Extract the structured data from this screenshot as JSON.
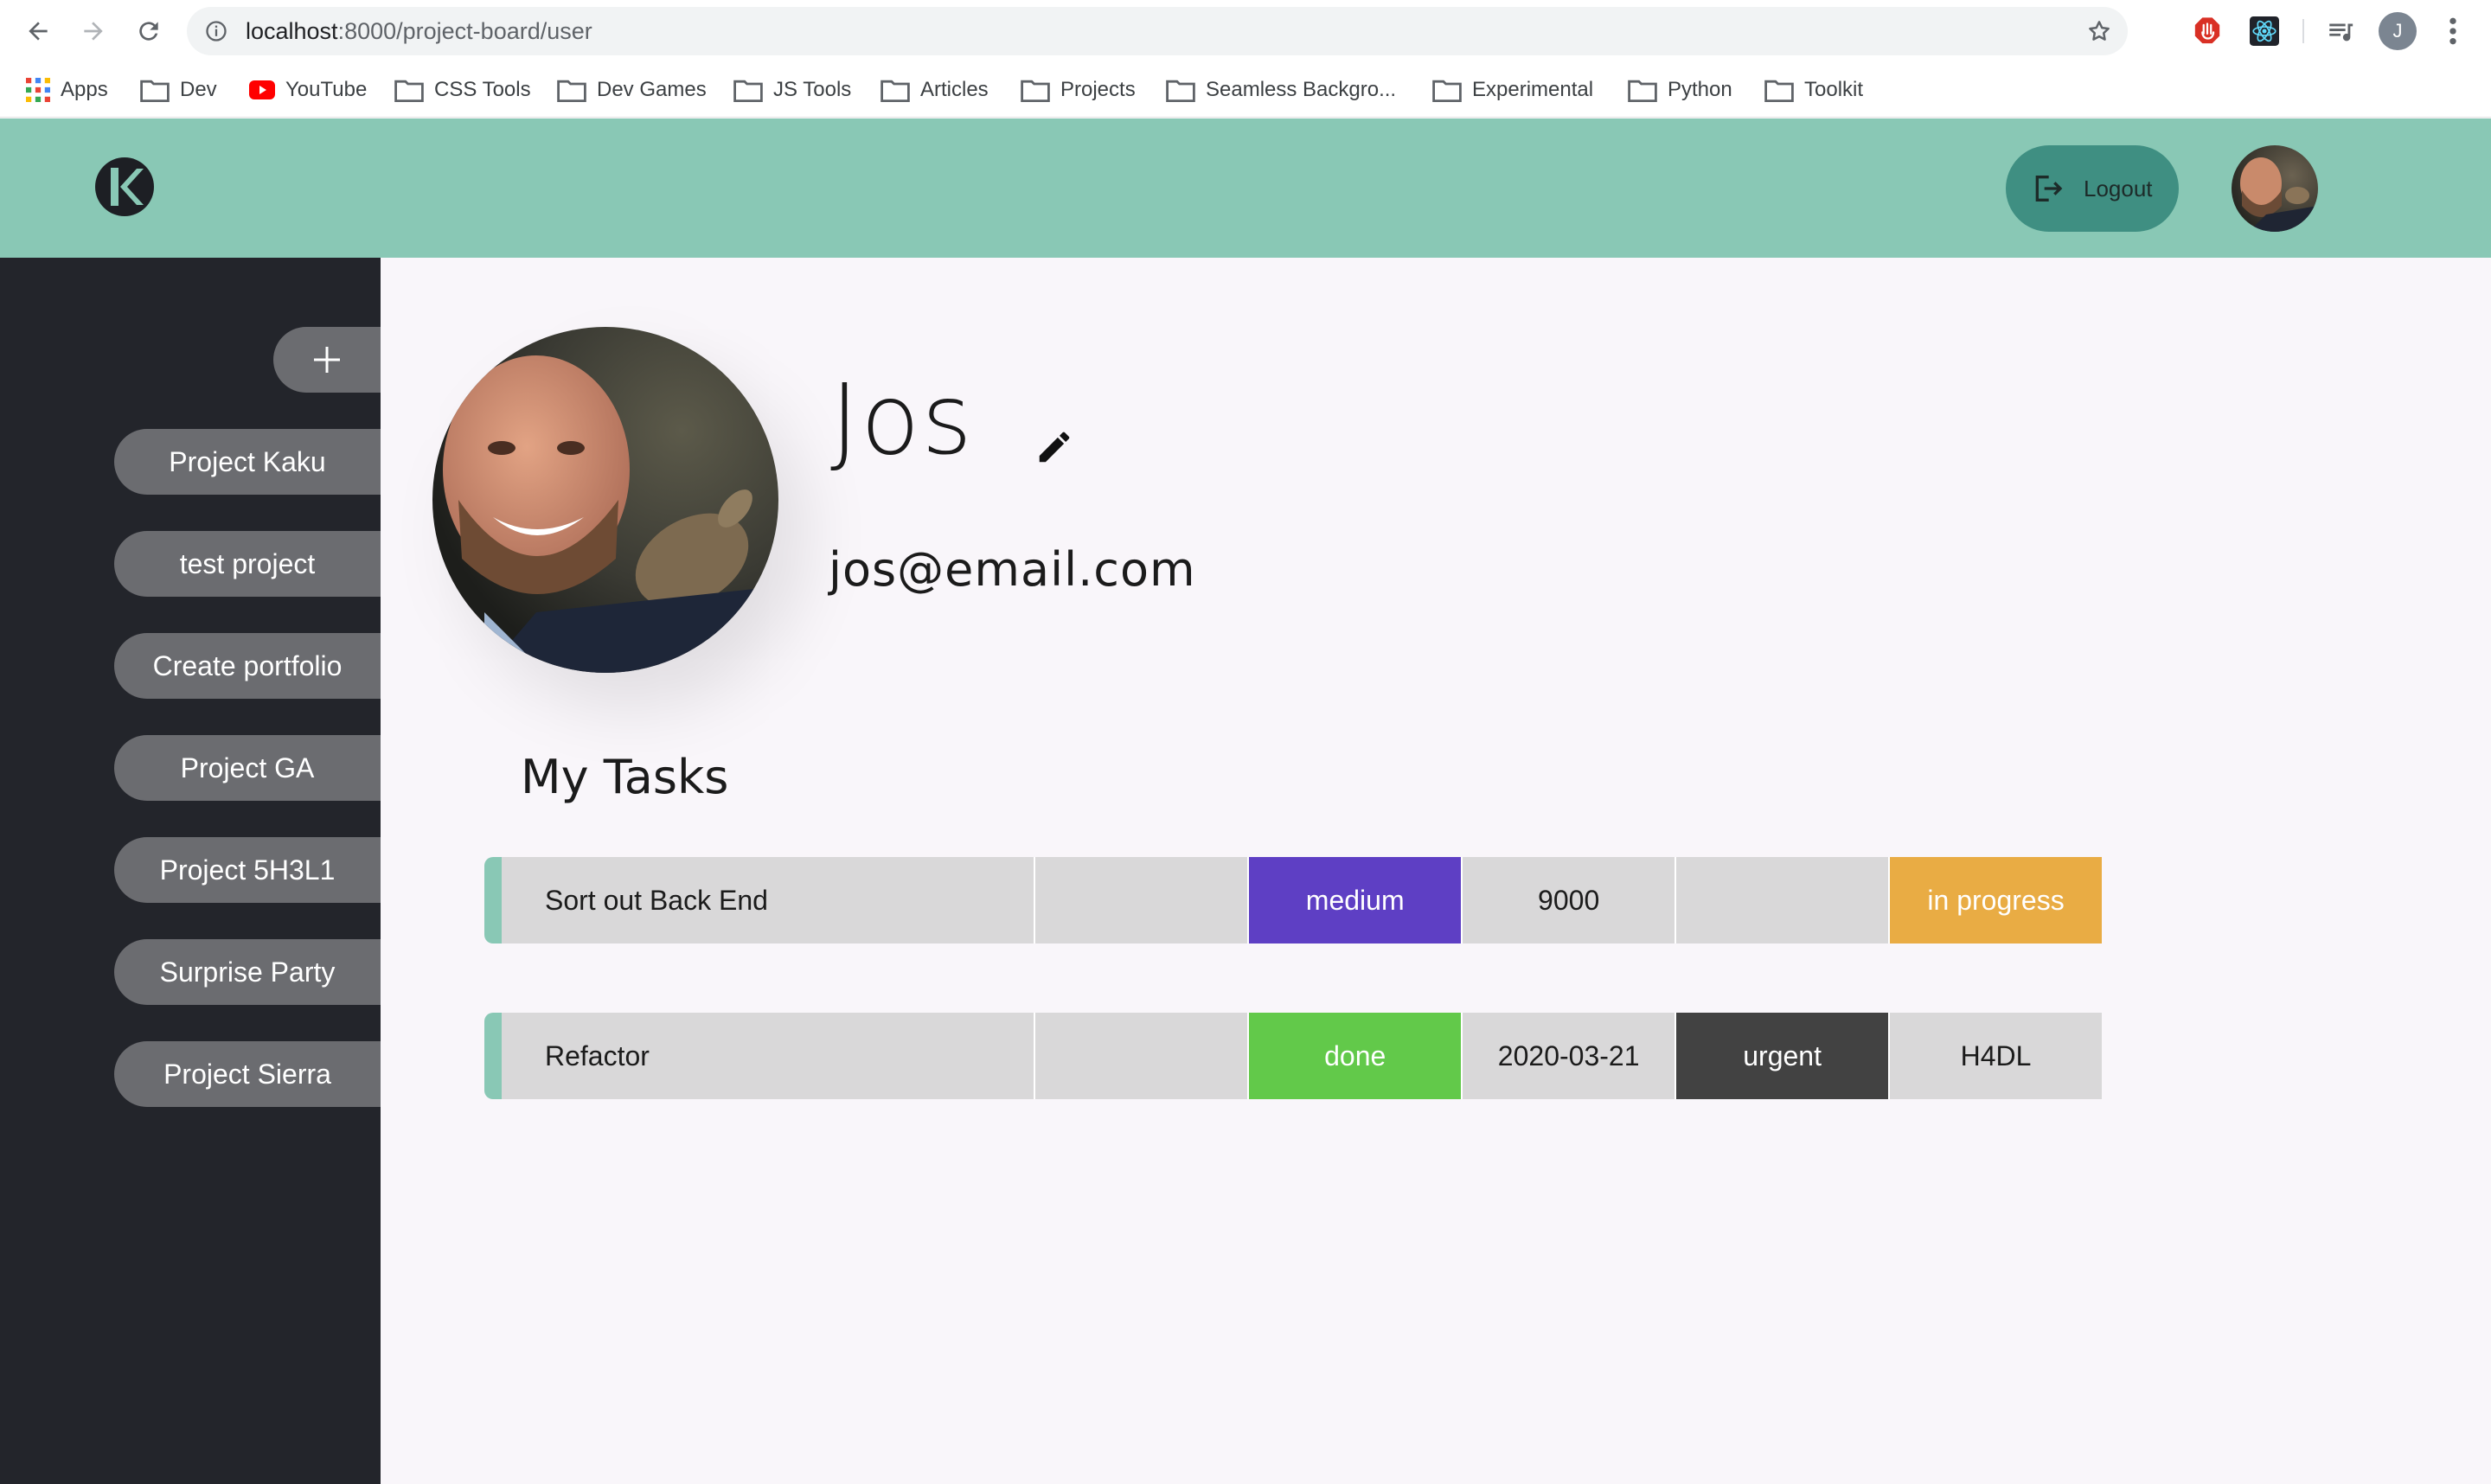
{
  "browser": {
    "url_host": "localhost",
    "url_rest": ":8000/project-board/user",
    "profile_initial": "J",
    "icons": [
      "back-arrow-icon",
      "forward-arrow-icon",
      "reload-icon",
      "info-icon",
      "star-icon",
      "adblock-extension-icon",
      "react-devtools-icon",
      "media-queue-icon"
    ]
  },
  "bookmarks": [
    {
      "label": "Apps",
      "icon": "apps-grid-icon"
    },
    {
      "label": "Dev",
      "icon": "folder-icon"
    },
    {
      "label": "YouTube",
      "icon": "youtube-icon"
    },
    {
      "label": "CSS Tools",
      "icon": "folder-icon"
    },
    {
      "label": "Dev Games",
      "icon": "folder-icon"
    },
    {
      "label": "JS Tools",
      "icon": "folder-icon"
    },
    {
      "label": "Articles",
      "icon": "folder-icon"
    },
    {
      "label": "Projects",
      "icon": "folder-icon"
    },
    {
      "label": "Seamless Backgro...",
      "icon": "folder-icon"
    },
    {
      "label": "Experimental",
      "icon": "folder-icon"
    },
    {
      "label": "Python",
      "icon": "folder-icon"
    },
    {
      "label": "Toolkit",
      "icon": "folder-icon"
    }
  ],
  "header": {
    "logout_label": "Logout",
    "colors": {
      "bar": "#89c8b5",
      "logout": "#3f8f82"
    }
  },
  "sidebar": {
    "projects": [
      {
        "label": "Project Kaku"
      },
      {
        "label": "test project"
      },
      {
        "label": "Create portfolio"
      },
      {
        "label": "Project GA"
      },
      {
        "label": "Project 5H3L1"
      },
      {
        "label": "Surprise Party"
      },
      {
        "label": "Project Sierra"
      }
    ]
  },
  "profile": {
    "name": "Jos",
    "email": "jos@email.com"
  },
  "tasks": {
    "heading": "My Tasks",
    "rows": [
      {
        "cells": [
          {
            "text": "Sort out Back End",
            "bg": "#d9d8d9",
            "fg": "#1b1b1b"
          },
          {
            "text": "",
            "bg": "#d9d8d9",
            "fg": "#1b1b1b"
          },
          {
            "text": "medium",
            "bg": "#5e3fc4",
            "fg": "#ffffff"
          },
          {
            "text": "9000",
            "bg": "#d9d8d9",
            "fg": "#1b1b1b"
          },
          {
            "text": "",
            "bg": "#d9d8d9",
            "fg": "#1b1b1b"
          },
          {
            "text": "in progress",
            "bg": "#e9ac44",
            "fg": "#ffffff"
          }
        ]
      },
      {
        "cells": [
          {
            "text": "Refactor",
            "bg": "#d9d8d9",
            "fg": "#1b1b1b"
          },
          {
            "text": "",
            "bg": "#d9d8d9",
            "fg": "#1b1b1b"
          },
          {
            "text": "done",
            "bg": "#62c94a",
            "fg": "#ffffff"
          },
          {
            "text": "2020-03-21",
            "bg": "#d9d8d9",
            "fg": "#1b1b1b"
          },
          {
            "text": "urgent",
            "bg": "#424242",
            "fg": "#ffffff"
          },
          {
            "text": "H4DL",
            "bg": "#d9d8d9",
            "fg": "#1b1b1b"
          }
        ]
      }
    ]
  }
}
